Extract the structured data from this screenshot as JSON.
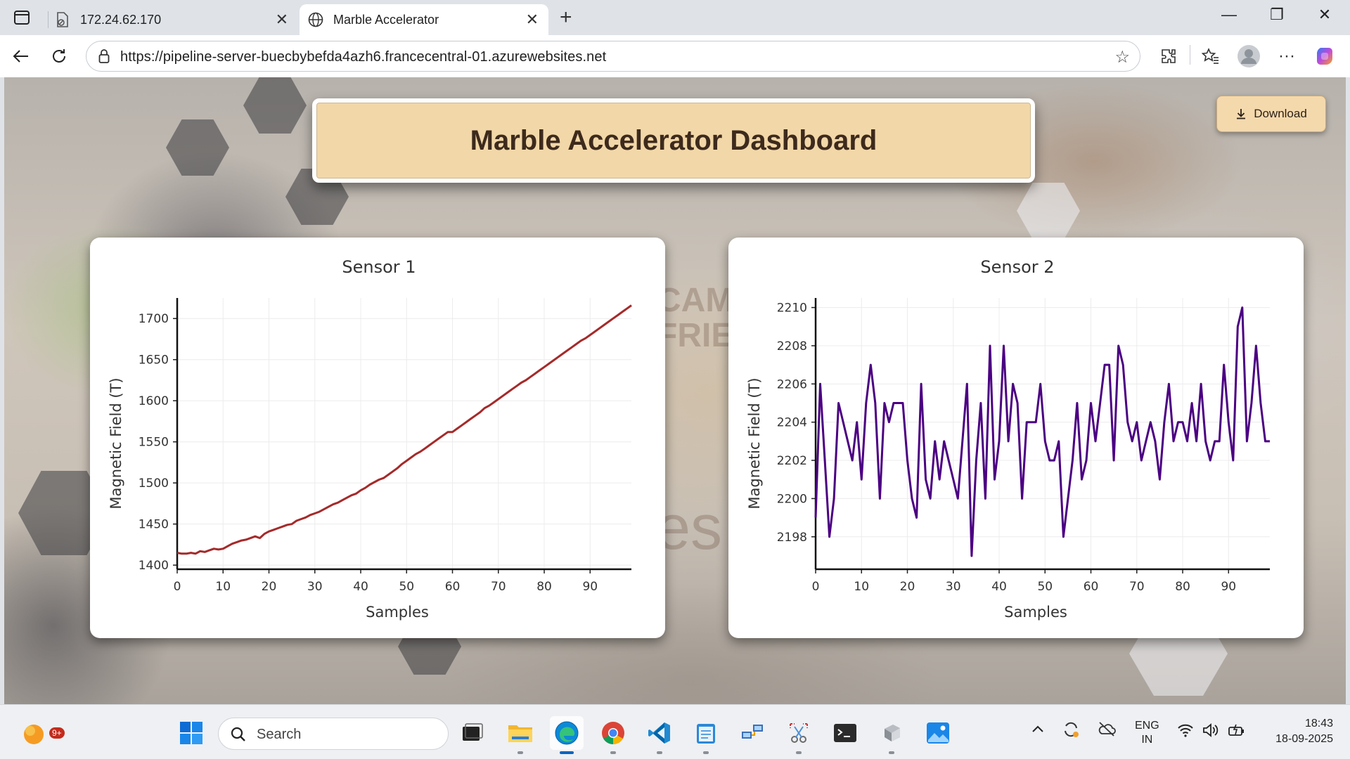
{
  "browser": {
    "tabs": [
      {
        "title": "172.24.62.170"
      },
      {
        "title": "Marble Accelerator"
      }
    ],
    "url": "https://pipeline-server-buecbybefda4azh6.francecentral-01.azurewebsites.net"
  },
  "page": {
    "title": "Marble Accelerator Dashboard",
    "download_label": "Download",
    "background_text": [
      "CAM",
      "FRIE",
      "es"
    ]
  },
  "chart_data": [
    {
      "type": "line",
      "title": "Sensor 1",
      "xlabel": "Samples",
      "ylabel": "Magnetic Field (T)",
      "xlim": [
        0,
        99
      ],
      "ylim": [
        1395,
        1725
      ],
      "xticks": [
        0,
        10,
        20,
        30,
        40,
        50,
        60,
        70,
        80,
        90
      ],
      "yticks": [
        1400,
        1450,
        1500,
        1550,
        1600,
        1650,
        1700
      ],
      "color": "#a52a2a",
      "series": [
        {
          "values": [
            1415,
            1414,
            1414,
            1415,
            1414,
            1417,
            1416,
            1418,
            1420,
            1419,
            1420,
            1423,
            1426,
            1428,
            1430,
            1431,
            1433,
            1435,
            1433,
            1438,
            1441,
            1443,
            1445,
            1447,
            1449,
            1450,
            1454,
            1456,
            1458,
            1461,
            1463,
            1465,
            1468,
            1471,
            1474,
            1476,
            1479,
            1482,
            1485,
            1487,
            1491,
            1494,
            1498,
            1501,
            1504,
            1506,
            1510,
            1514,
            1518,
            1523,
            1527,
            1531,
            1535,
            1538,
            1542,
            1546,
            1550,
            1554,
            1558,
            1562,
            1562,
            1566,
            1570,
            1574,
            1578,
            1582,
            1586,
            1591,
            1594,
            1598,
            1602,
            1606,
            1610,
            1614,
            1618,
            1622,
            1625,
            1629,
            1633,
            1637,
            1641,
            1645,
            1649,
            1653,
            1657,
            1661,
            1665,
            1669,
            1673,
            1676,
            1680,
            1684,
            1688,
            1692,
            1696,
            1700,
            1704,
            1708,
            1712,
            1716
          ]
        }
      ]
    },
    {
      "type": "line",
      "title": "Sensor 2",
      "xlabel": "Samples",
      "ylabel": "Magnetic Field (T)",
      "xlim": [
        0,
        99
      ],
      "ylim": [
        2196.3,
        2210.5
      ],
      "xticks": [
        0,
        10,
        20,
        30,
        40,
        50,
        60,
        70,
        80,
        90
      ],
      "yticks": [
        2198,
        2200,
        2202,
        2204,
        2206,
        2208,
        2210
      ],
      "color": "#4b0082",
      "series": [
        {
          "values": [
            2199,
            2206,
            2202,
            2198,
            2200,
            2205,
            2204,
            2203,
            2202,
            2204,
            2201,
            2205,
            2207,
            2205,
            2200,
            2205,
            2204,
            2205,
            2205,
            2205,
            2202,
            2200,
            2199,
            2206,
            2201,
            2200,
            2203,
            2201,
            2203,
            2202,
            2201,
            2200,
            2203,
            2206,
            2197,
            2202,
            2205,
            2200,
            2208,
            2201,
            2203,
            2208,
            2203,
            2206,
            2205,
            2200,
            2204,
            2204,
            2204,
            2206,
            2203,
            2202,
            2202,
            2203,
            2198,
            2200,
            2202,
            2205,
            2201,
            2202,
            2205,
            2203,
            2205,
            2207,
            2207,
            2202,
            2208,
            2207,
            2204,
            2203,
            2204,
            2202,
            2203,
            2204,
            2203,
            2201,
            2204,
            2206,
            2203,
            2204,
            2204,
            2203,
            2205,
            2203,
            2206,
            2203,
            2202,
            2203,
            2203,
            2207,
            2204,
            2202,
            2209,
            2210,
            2203,
            2205,
            2208,
            2205,
            2203,
            2203
          ]
        }
      ]
    }
  ],
  "taskbar": {
    "search_placeholder": "Search",
    "notification_badge": "9+",
    "language": "ENG",
    "region": "IN",
    "time": "18:43",
    "date": "18-09-2025",
    "apps": [
      "widgets-icon",
      "start-icon",
      "search",
      "task-view-icon",
      "file-explorer-icon",
      "edge-icon",
      "chrome-icon",
      "vscode-icon",
      "notepad-icon",
      "network-icon",
      "snipping-icon",
      "terminal-icon",
      "device-icon",
      "photos-icon"
    ]
  }
}
